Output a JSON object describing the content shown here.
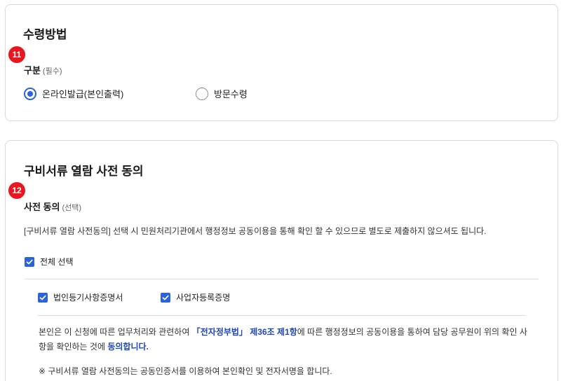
{
  "receipt": {
    "badge": "11",
    "title": "수령방법",
    "label": "구분",
    "label_sub": "(필수)",
    "options": [
      {
        "label": "온라인발급(본인출력)",
        "selected": true
      },
      {
        "label": "방문수령",
        "selected": false
      }
    ]
  },
  "consent": {
    "badge": "12",
    "title": "구비서류 열람 사전 동의",
    "label": "사전 동의",
    "label_sub": "(선택)",
    "description": "[구비서류 열람 사전동의] 선택 시 민원처리기관에서 행정정보 공동이용을 통해 확인 할 수 있으므로 별도로 제출하지 않으셔도 됩니다.",
    "select_all": {
      "label": "전체 선택",
      "checked": true
    },
    "documents": [
      {
        "label": "법인등기사항증명서",
        "checked": true
      },
      {
        "label": "사업자등록증명",
        "checked": true
      }
    ],
    "agree_text": {
      "part1": "본인은 이 신청에 따른 업무처리와 관련하여 ",
      "law": "「전자정부법」 제36조 제1항",
      "part2": "에 따른 행정정보의 공동이용을 통하여 담당 공무원이 위의 확인 사항을 확인하는 것에 ",
      "agree": "동의합니다."
    },
    "note": "※ 구비서류 열람 사전동의는 공동인증서를 이용하여 본인확인 및 전자서명을 합니다."
  },
  "colors": {
    "accent": "#2b63d9",
    "badge": "#e8161f",
    "highlight": "#1f47b8",
    "border": "#d7d9de"
  }
}
